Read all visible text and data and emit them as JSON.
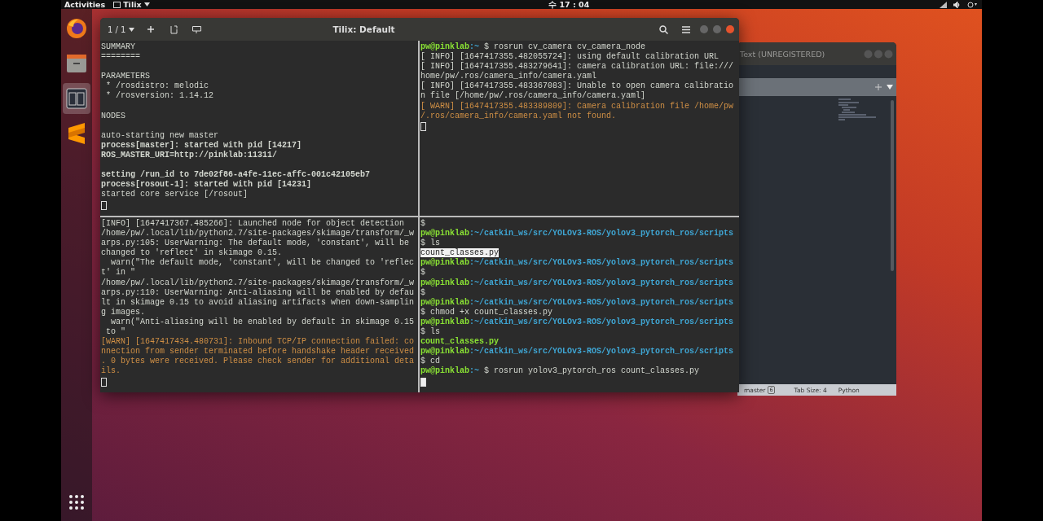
{
  "top_bar": {
    "activities": "Activities",
    "app_menu": "Tilix",
    "clock": "수 17 : 04"
  },
  "dock": {
    "items": [
      {
        "kind": "firefox",
        "selected": false
      },
      {
        "kind": "files",
        "selected": false
      },
      {
        "kind": "terminal",
        "selected": true
      },
      {
        "kind": "editor",
        "selected": false
      }
    ]
  },
  "editor": {
    "title": "Text (UNREGISTERED)",
    "status_bar": {
      "branch": "master",
      "branch_count": "6",
      "tab_size": "Tab Size: 4",
      "syntax": "Python"
    }
  },
  "terminal": {
    "session": "1 / 1",
    "title": "Tilix: Default",
    "panes": [
      {
        "cursor_focused": false,
        "lines": [
          {
            "kind": "plain",
            "text": "SUMMARY"
          },
          {
            "kind": "plain",
            "text": "========"
          },
          {
            "kind": "blank"
          },
          {
            "kind": "plain",
            "text": "PARAMETERS"
          },
          {
            "kind": "plain",
            "text": " * /rosdistro: melodic"
          },
          {
            "kind": "plain",
            "text": " * /rosversion: 1.14.12"
          },
          {
            "kind": "blank"
          },
          {
            "kind": "plain",
            "text": "NODES"
          },
          {
            "kind": "blank"
          },
          {
            "kind": "plain",
            "text": "auto-starting new master"
          },
          {
            "kind": "bold",
            "text": "process[master]: started with pid [14217]"
          },
          {
            "kind": "bold",
            "text": "ROS_MASTER_URI=http://pinklab:11311/"
          },
          {
            "kind": "blank"
          },
          {
            "kind": "bold",
            "text": "setting /run_id to 7de02f86-a4fe-11ec-affc-001c42105eb7"
          },
          {
            "kind": "bold",
            "text": "process[rosout-1]: started with pid [14231]"
          },
          {
            "kind": "plain",
            "text": "started core service [/rosout]"
          }
        ]
      },
      {
        "cursor_focused": false,
        "lines": [
          {
            "kind": "prompt",
            "user": "pw@pinklab",
            "path": ":~",
            "command": "$ rosrun cv_camera cv_camera_node"
          },
          {
            "kind": "plain",
            "text": "[ INFO] [1647417355.482055724]: using default calibration URL"
          },
          {
            "kind": "plain",
            "text": "[ INFO] [1647417355.483279641]: camera calibration URL: file:///"
          },
          {
            "kind": "plain",
            "text": "home/pw/.ros/camera_info/camera.yaml"
          },
          {
            "kind": "plain",
            "text": "[ INFO] [1647417355.483367083]: Unable to open camera calibratio"
          },
          {
            "kind": "plain",
            "text": "n file [/home/pw/.ros/camera_info/camera.yaml]"
          },
          {
            "kind": "warn",
            "text": "[ WARN] [1647417355.483389809]: Camera calibration file /home/pw"
          },
          {
            "kind": "warn",
            "text": "/.ros/camera_info/camera.yaml not found."
          }
        ]
      },
      {
        "cursor_focused": false,
        "lines": [
          {
            "kind": "plain",
            "text": "[INFO] [1647417367.485266]: Launched node for object detection"
          },
          {
            "kind": "plain",
            "text": "/home/pw/.local/lib/python2.7/site-packages/skimage/transform/_w"
          },
          {
            "kind": "plain",
            "text": "arps.py:105: UserWarning: The default mode, 'constant', will be"
          },
          {
            "kind": "plain",
            "text": "changed to 'reflect' in skimage 0.15."
          },
          {
            "kind": "plain",
            "text": "  warn(\"The default mode, 'constant', will be changed to 'reflec"
          },
          {
            "kind": "plain",
            "text": "t' in \""
          },
          {
            "kind": "plain",
            "text": "/home/pw/.local/lib/python2.7/site-packages/skimage/transform/_w"
          },
          {
            "kind": "plain",
            "text": "arps.py:110: UserWarning: Anti-aliasing will be enabled by defau"
          },
          {
            "kind": "plain",
            "text": "lt in skimage 0.15 to avoid aliasing artifacts when down-samplin"
          },
          {
            "kind": "plain",
            "text": "g images."
          },
          {
            "kind": "plain",
            "text": "  warn(\"Anti-aliasing will be enabled by default in skimage 0.15"
          },
          {
            "kind": "plain",
            "text": " to \""
          },
          {
            "kind": "warn",
            "text": "[WARN] [1647417434.480731]: Inbound TCP/IP connection failed: co"
          },
          {
            "kind": "warn",
            "text": "nnection from sender terminated before handshake header received"
          },
          {
            "kind": "warn",
            "text": ". 0 bytes were received. Please check sender for additional deta"
          },
          {
            "kind": "warn",
            "text": "ils."
          }
        ]
      },
      {
        "cursor_focused": true,
        "lines": [
          {
            "kind": "plain",
            "text": "$"
          },
          {
            "kind": "prompt",
            "user": "pw@pinklab",
            "path": ":~/catkin_ws/src/YOLOv3-ROS/yolov3_pytorch_ros/scripts"
          },
          {
            "kind": "plain",
            "text": "$ ls"
          },
          {
            "kind": "selected",
            "text": "count_classes.py"
          },
          {
            "kind": "prompt",
            "user": "pw@pinklab",
            "path": ":~/catkin_ws/src/YOLOv3-ROS/yolov3_pytorch_ros/scripts"
          },
          {
            "kind": "plain",
            "text": "$"
          },
          {
            "kind": "prompt",
            "user": "pw@pinklab",
            "path": ":~/catkin_ws/src/YOLOv3-ROS/yolov3_pytorch_ros/scripts"
          },
          {
            "kind": "plain",
            "text": "$"
          },
          {
            "kind": "prompt",
            "user": "pw@pinklab",
            "path": ":~/catkin_ws/src/YOLOv3-ROS/yolov3_pytorch_ros/scripts"
          },
          {
            "kind": "plain",
            "text": "$ chmod +x count_classes.py"
          },
          {
            "kind": "prompt",
            "user": "pw@pinklab",
            "path": ":~/catkin_ws/src/YOLOv3-ROS/yolov3_pytorch_ros/scripts"
          },
          {
            "kind": "plain",
            "text": "$ ls"
          },
          {
            "kind": "exec",
            "text": "count_classes.py"
          },
          {
            "kind": "prompt",
            "user": "pw@pinklab",
            "path": ":~/catkin_ws/src/YOLOv3-ROS/yolov3_pytorch_ros/scripts"
          },
          {
            "kind": "plain",
            "text": "$ cd"
          },
          {
            "kind": "prompt",
            "user": "pw@pinklab",
            "path": ":~",
            "command": "$ rosrun yolov3_pytorch_ros count_classes.py"
          }
        ]
      }
    ]
  }
}
